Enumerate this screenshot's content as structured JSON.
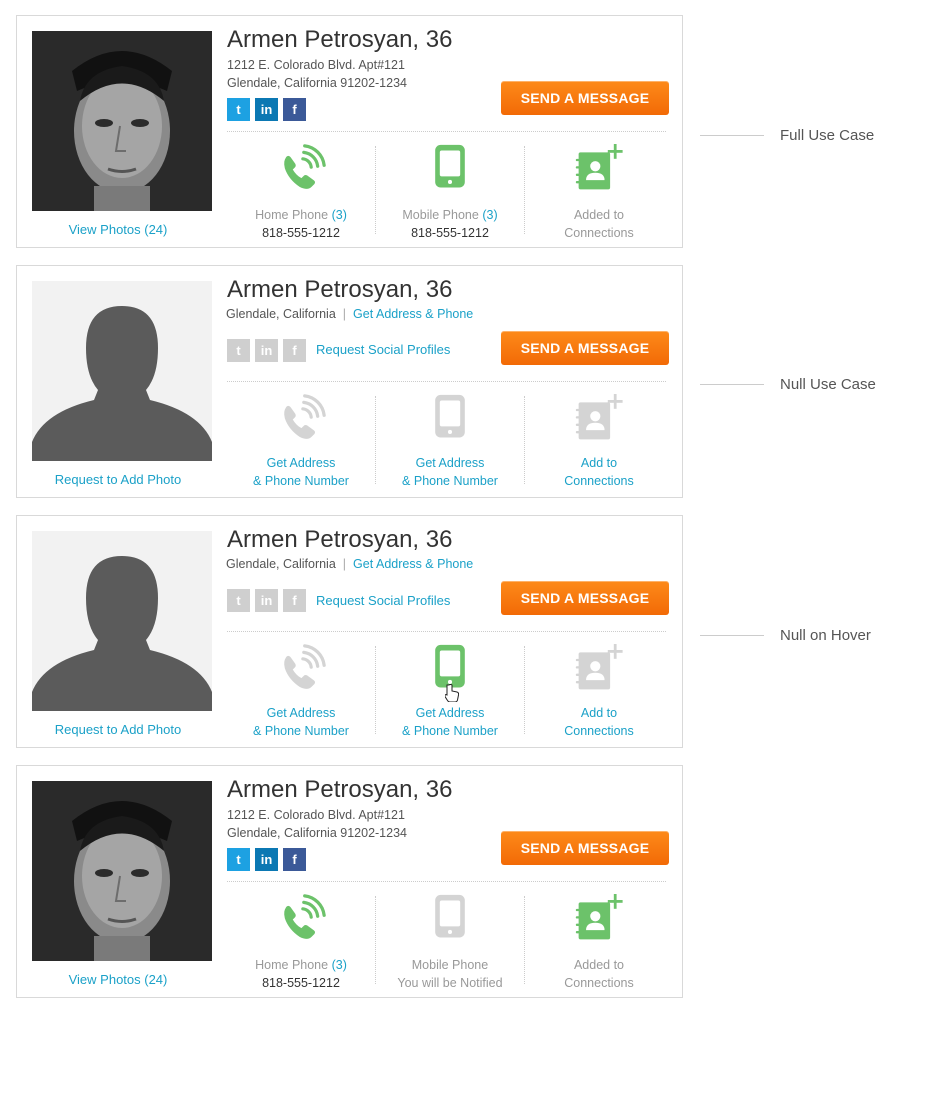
{
  "colors": {
    "accent_link": "#1ba1c8",
    "icon_green": "#6cc26a",
    "icon_gray": "#d4d4d4",
    "button_orange": "#f47b0f"
  },
  "cards": [
    {
      "label": "Full Use Case",
      "name": "Armen Petrosyan, 36",
      "address_line1": "1212 E. Colorado Blvd. Apt#121",
      "address_line2": "Glendale, California 91202-1234",
      "photo_link": "View Photos (24)",
      "send_button": "SEND A MESSAGE",
      "home_label": "Home Phone",
      "home_count": "(3)",
      "home_number": "818-555-1212",
      "mobile_label": "Mobile Phone",
      "mobile_count": "(3)",
      "mobile_number": "818-555-1212",
      "connections_line1": "Added to",
      "connections_line2": "Connections"
    },
    {
      "label": "Null Use Case",
      "name": "Armen Petrosyan, 36",
      "city": "Glendale, California",
      "separator": "|",
      "get_address_link": "Get Address & Phone",
      "request_social": "Request Social Profiles",
      "photo_link": "Request to Add Photo",
      "send_button": "SEND A MESSAGE",
      "home_line1": "Get Address",
      "home_line2": "& Phone Number",
      "mobile_line1": "Get Address",
      "mobile_line2": "& Phone Number",
      "connections_line1": "Add to",
      "connections_line2": "Connections"
    },
    {
      "label": "Null on Hover",
      "name": "Armen Petrosyan, 36",
      "city": "Glendale, California",
      "separator": "|",
      "get_address_link": "Get Address & Phone",
      "request_social": "Request Social Profiles",
      "photo_link": "Request to Add Photo",
      "send_button": "SEND A MESSAGE",
      "home_line1": "Get Address",
      "home_line2": "& Phone Number",
      "mobile_line1": "Get Address",
      "mobile_line2": "& Phone Number",
      "connections_line1": "Add to",
      "connections_line2": "Connections"
    },
    {
      "name": "Armen Petrosyan, 36",
      "address_line1": "1212 E. Colorado Blvd. Apt#121",
      "address_line2": "Glendale, California 91202-1234",
      "photo_link": "View Photos (24)",
      "send_button": "SEND A MESSAGE",
      "home_label": "Home Phone",
      "home_count": "(3)",
      "home_number": "818-555-1212",
      "mobile_line1": "Mobile Phone",
      "mobile_line2": "You will be Notified",
      "connections_line1": "Added to",
      "connections_line2": "Connections"
    }
  ],
  "social_icons": {
    "twitter": "t",
    "linkedin": "in",
    "facebook": "f"
  }
}
